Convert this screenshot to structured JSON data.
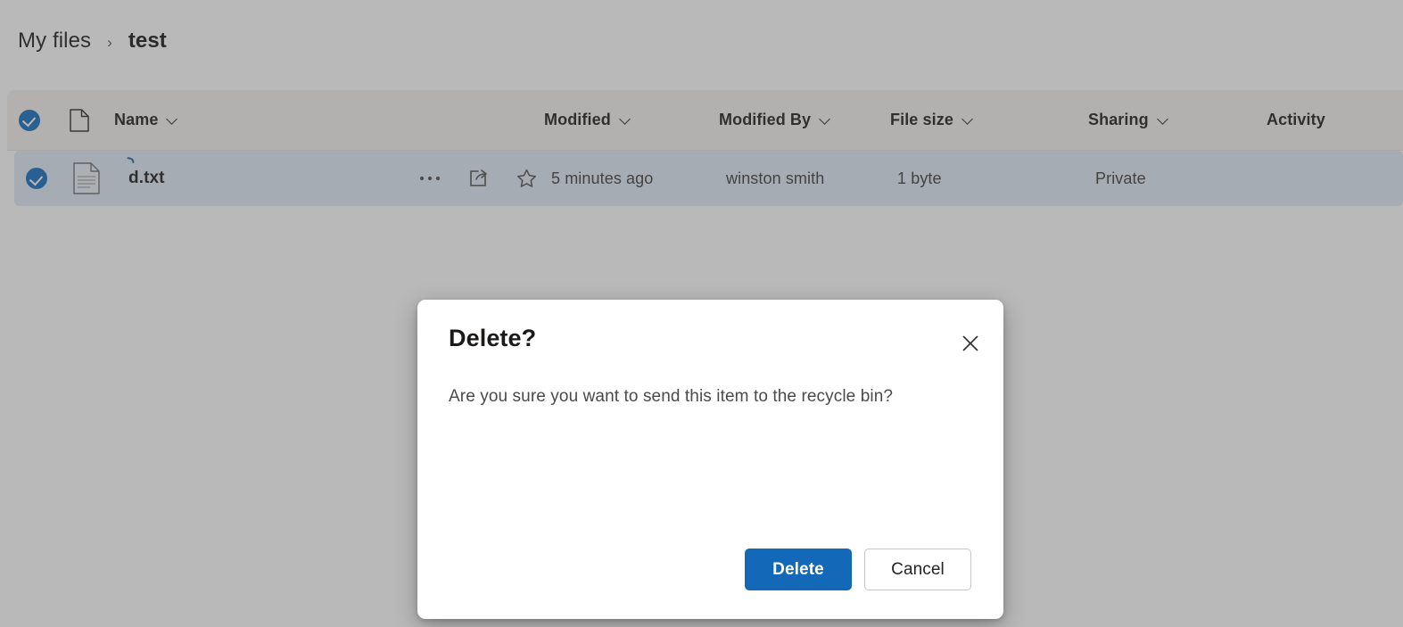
{
  "breadcrumb": {
    "root": "My files",
    "separator": "›",
    "current": "test"
  },
  "colors": {
    "accent": "#0f6cbd",
    "primary_button": "#1368b8",
    "header_bg": "#f3f2f1",
    "selected_row_bg": "#dfeaf5",
    "overlay": "rgba(80,80,80,0.40)"
  },
  "file_list": {
    "columns": [
      {
        "key": "name",
        "label": "Name",
        "sortable": true
      },
      {
        "key": "modified",
        "label": "Modified",
        "sortable": true
      },
      {
        "key": "modified_by",
        "label": "Modified By",
        "sortable": true
      },
      {
        "key": "file_size",
        "label": "File size",
        "sortable": true
      },
      {
        "key": "sharing",
        "label": "Sharing",
        "sortable": true
      },
      {
        "key": "activity",
        "label": "Activity",
        "sortable": false
      }
    ],
    "select_all_checked": true,
    "rows": [
      {
        "selected": true,
        "name": "d.txt",
        "modified": "5 minutes ago",
        "modified_by": "winston smith",
        "file_size": "1 byte",
        "sharing": "Private",
        "activity": "",
        "actions": [
          "more-actions",
          "share",
          "favorite"
        ]
      }
    ]
  },
  "dialog": {
    "title": "Delete?",
    "message": "Are you sure you want to send this item to the recycle bin?",
    "confirm_label": "Delete",
    "cancel_label": "Cancel",
    "close_label": "Close"
  }
}
